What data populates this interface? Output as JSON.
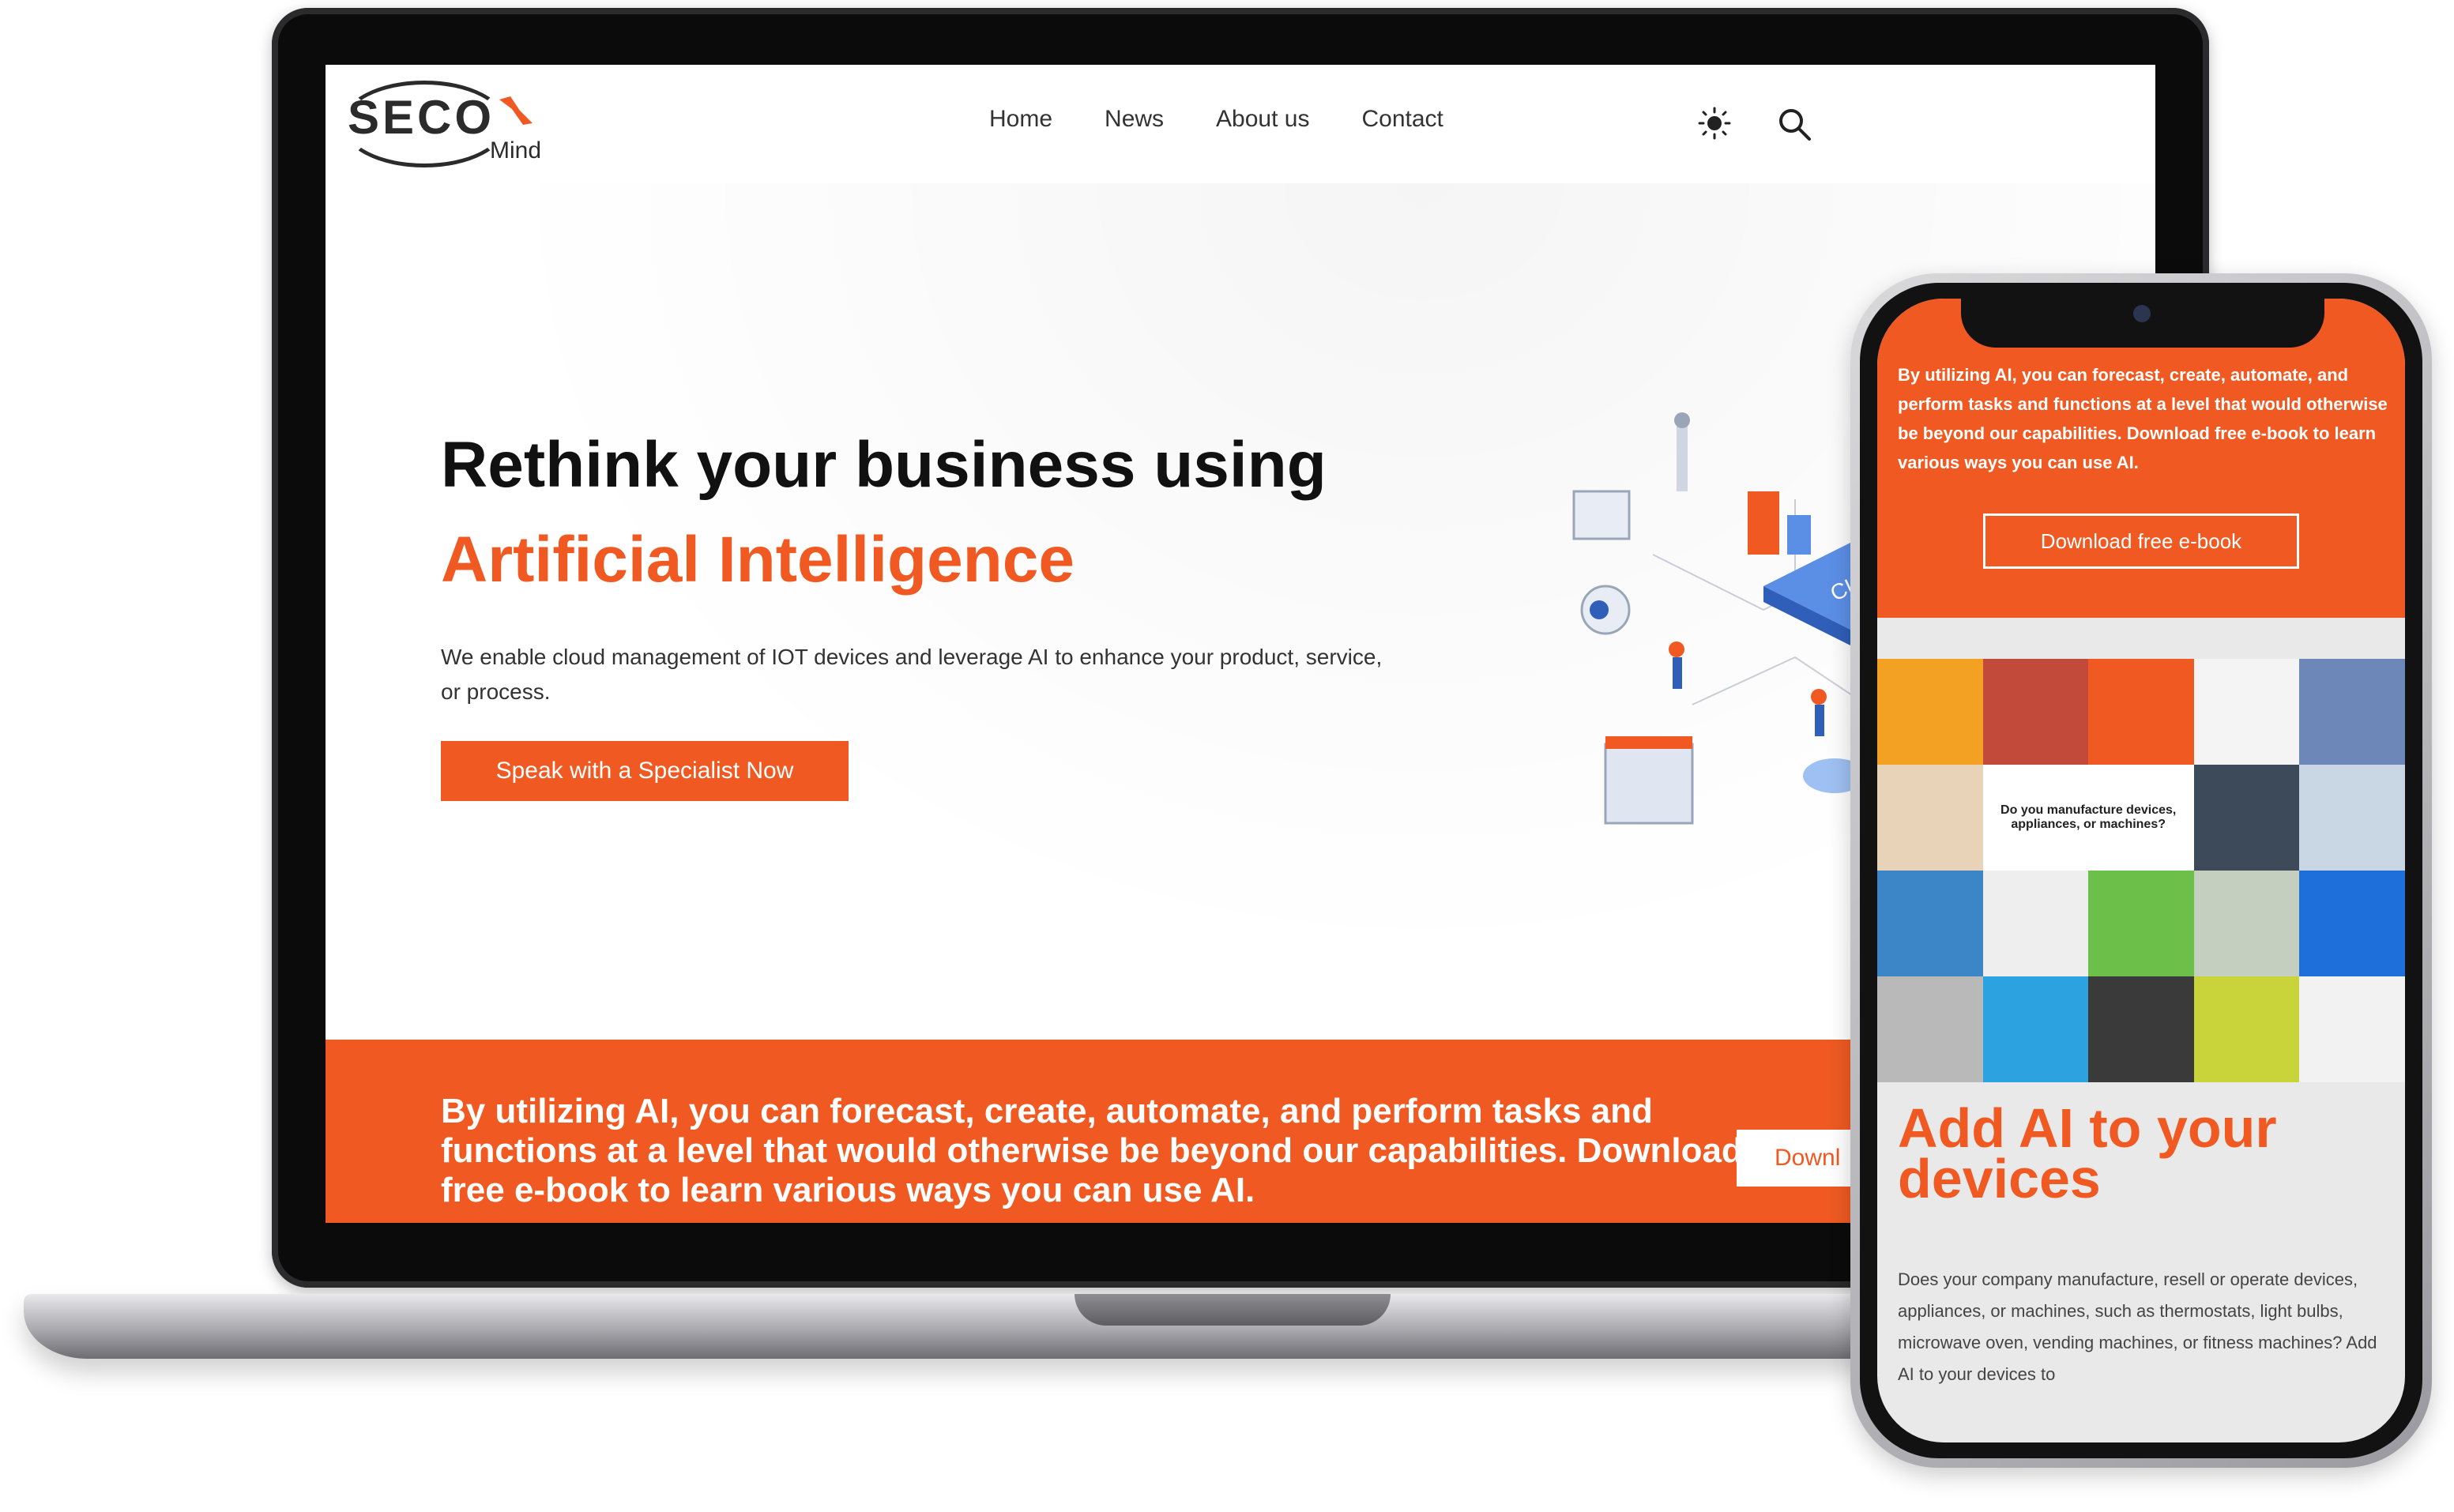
{
  "laptop": {
    "logo": {
      "brand": "SECO",
      "sub": "Mind"
    },
    "nav": [
      "Home",
      "News",
      "About us",
      "Contact"
    ],
    "hero": {
      "title_line1": "Rethink your business using",
      "title_line2": "Artificial Intelligence",
      "description": "We enable cloud management of IOT devices and leverage AI to enhance your product, service, or process.",
      "cta": "Speak with a Specialist Now"
    },
    "illustration_label": "CLEA",
    "band": {
      "text": "By utilizing AI, you can forecast, create, automate, and perform tasks and functions at a level that would otherwise be beyond our capabilities. Download free e-book to learn various ways you can use AI.",
      "button": "Downl"
    }
  },
  "phone": {
    "band_text": "By utilizing AI, you can forecast, create, automate, and perform tasks and functions at a level that would otherwise be beyond our capabilities. Download free e-book to learn various ways you can use AI.",
    "button": "Download free e-book",
    "grid_center_text": "Do you manufacture devices, appliances, or machines?",
    "heading": "Add AI to your devices",
    "body": "Does your company manufacture, resell or operate devices, appliances, or machines, such as thermostats, light bulbs, microwave oven, vending machines, or fitness machines? Add AI to your devices to"
  },
  "colors": {
    "accent": "#f05a22",
    "text_dark": "#111111"
  }
}
